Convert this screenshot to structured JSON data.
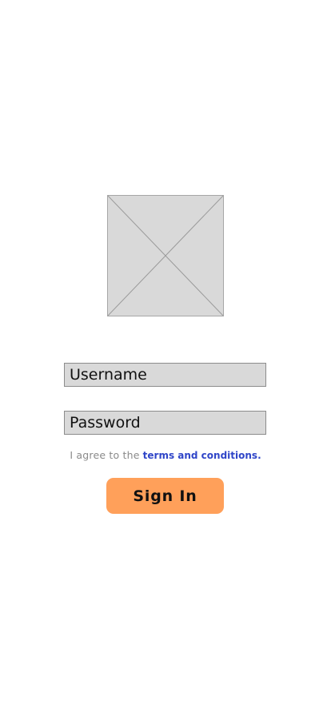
{
  "logo": {
    "icon": "image-placeholder-icon"
  },
  "form": {
    "username_placeholder": "Username",
    "password_placeholder": "Password"
  },
  "terms": {
    "lead_text": "I agree to the",
    "link_text": "terms and conditions."
  },
  "signin_button": {
    "label": "Sign In"
  },
  "colors": {
    "background": "#ffffff",
    "field_fill": "#d9d9d9",
    "field_border": "#8c8c8c",
    "link": "#2f45c8",
    "button": "#ffa05a",
    "muted_text": "#8a8a8a"
  }
}
